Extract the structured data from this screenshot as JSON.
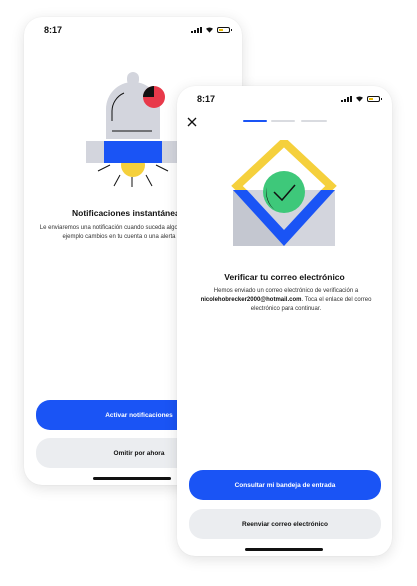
{
  "back_screen": {
    "status_time": "8:17",
    "title": "Notificaciones instantáneas",
    "description": "Le enviaremos una notificación cuando suceda algo importante, como por ejemplo cambios en tu cuenta o una alerta de seguridad.",
    "primary_button": "Activar notificaciones",
    "secondary_button": "Omitir por ahora"
  },
  "front_screen": {
    "status_time": "8:17",
    "progress_steps": 3,
    "progress_current": 1,
    "title": "Verificar tu correo electrónico",
    "description_before": "Hemos enviado un correo electrónico de verificación a ",
    "email": "nicolehobrecker2000@hotmail.com",
    "description_after": ". Toca el enlace del correo electrónico para continuar.",
    "primary_button": "Consultar mi bandeja de entrada",
    "secondary_button": "Reenviar correo electrónico"
  },
  "colors": {
    "accent": "#1a54f5",
    "secondary_bg": "#ebedf0",
    "alert_red": "#e8394a",
    "yellow": "#f5d03c",
    "green": "#3ec87a",
    "grey_illustration": "#d3d5dd"
  },
  "icons": [
    "signal-icon",
    "wifi-icon",
    "battery-icon",
    "close-icon",
    "bell-illustration",
    "envelope-check-illustration"
  ]
}
